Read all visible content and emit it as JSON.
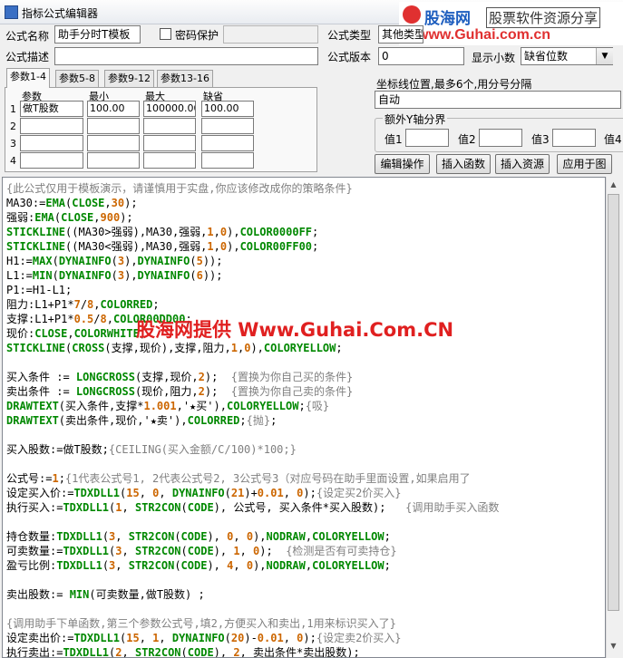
{
  "window": {
    "title": "指标公式编辑器"
  },
  "watermark": {
    "brand": "股海网",
    "slogan": "股票软件资源分享",
    "url": "www.Guhai.com.cn",
    "center_text": "股海网提供 Www.Guhai.Com.CN"
  },
  "form": {
    "name_label": "公式名称",
    "name_value": "助手分时T模板",
    "password_label": "密码保护",
    "password_value": "",
    "type_label": "公式类型",
    "type_value": "其他类型",
    "desc_label": "公式描述",
    "desc_value": "",
    "version_label": "公式版本",
    "version_value": "0",
    "decimals_label": "显示小数",
    "decimals_value": "缺省位数"
  },
  "tabs": [
    "参数1-4",
    "参数5-8",
    "参数9-12",
    "参数13-16"
  ],
  "params": {
    "headers": [
      "参数",
      "最小",
      "最大",
      "缺省"
    ],
    "rows": [
      {
        "num": "1",
        "name": "做T股数",
        "min": "100.00",
        "max": "100000.00",
        "default": "100.00"
      },
      {
        "num": "2",
        "name": "",
        "min": "",
        "max": "",
        "default": ""
      },
      {
        "num": "3",
        "name": "",
        "min": "",
        "max": "",
        "default": ""
      },
      {
        "num": "4",
        "name": "",
        "min": "",
        "max": "",
        "default": ""
      }
    ]
  },
  "axis": {
    "label": "坐标线位置,最多6个,用分号分隔",
    "value": "自动",
    "extra_group": "额外Y轴分界",
    "val1": "值1",
    "val2": "值2",
    "val3": "值3",
    "val4": "值4"
  },
  "buttons": {
    "edit": "编辑操作",
    "insert_fn": "插入函数",
    "insert_res": "插入资源",
    "apply": "应用于图"
  },
  "code_lines": [
    "{此公式仅用于模板演示，请谨慎用于实盘,你应该修改成你的策略条件}",
    "MA30:=EMA(CLOSE,30);",
    "强弱:EMA(CLOSE,900);",
    "STICKLINE((MA30>强弱),MA30,强弱,1,0),COLOR0000FF;",
    "STICKLINE((MA30<强弱),MA30,强弱,1,0),COLOR00FF00;",
    "H1:=MAX(DYNAINFO(3),DYNAINFO(5));",
    "L1:=MIN(DYNAINFO(3),DYNAINFO(6));",
    "P1:=H1-L1;",
    "阻力:L1+P1*7/8,COLORRED;",
    "支撑:L1+P1*0.5/8,COLOR00DD00;",
    "现价:CLOSE,COLORWHITE;",
    "STICKLINE(CROSS(支撑,现价),支撑,阻力,1,0),COLORYELLOW;",
    "",
    "买入条件 := LONGCROSS(支撑,现价,2);  {置换为你自己买的条件}",
    "卖出条件 := LONGCROSS(现价,阻力,2);  {置换为你自己卖的条件}",
    "DRAWTEXT(买入条件,支撑*1.001,'★买'),COLORYELLOW;{吸}",
    "DRAWTEXT(卖出条件,现价,'★卖'),COLORRED;{抛};",
    "",
    "买入股数:=做T股数;{CEILING(买入金额/C/100)*100;}",
    "",
    "公式号:=1;{1代表公式号1, 2代表公式号2, 3公式号3（对应号码在助手里面设置,如果启用了",
    "设定买入价:=TDXDLL1(15, 0, DYNAINFO(21)+0.01, 0);{设定买2价买入}",
    "执行买入:=TDXDLL1(1, STR2CON(CODE), 公式号, 买入条件*买入股数);   {调用助手买入函数",
    "",
    "持仓数量:TDXDLL1(3, STR2CON(CODE), 0, 0),NODRAW,COLORYELLOW;",
    "可卖数量:=TDXDLL1(3, STR2CON(CODE), 1, 0);  {检测是否有可卖持仓}",
    "盈亏比例:TDXDLL1(3, STR2CON(CODE), 4, 0),NODRAW,COLORYELLOW;",
    "",
    "卖出股数:= MIN(可卖数量,做T股数) ;",
    "",
    "{调用助手下单函数,第三个参数公式号,填2,方便买入和卖出,1用来标识买入了}",
    "设定卖出价:=TDXDLL1(15, 1, DYNAINFO(20)-0.01, 0);{设定卖2价买入}",
    "执行卖出:=TDXDLL1(2, STR2CON(CODE), 2, 卖出条件*卖出股数);"
  ]
}
